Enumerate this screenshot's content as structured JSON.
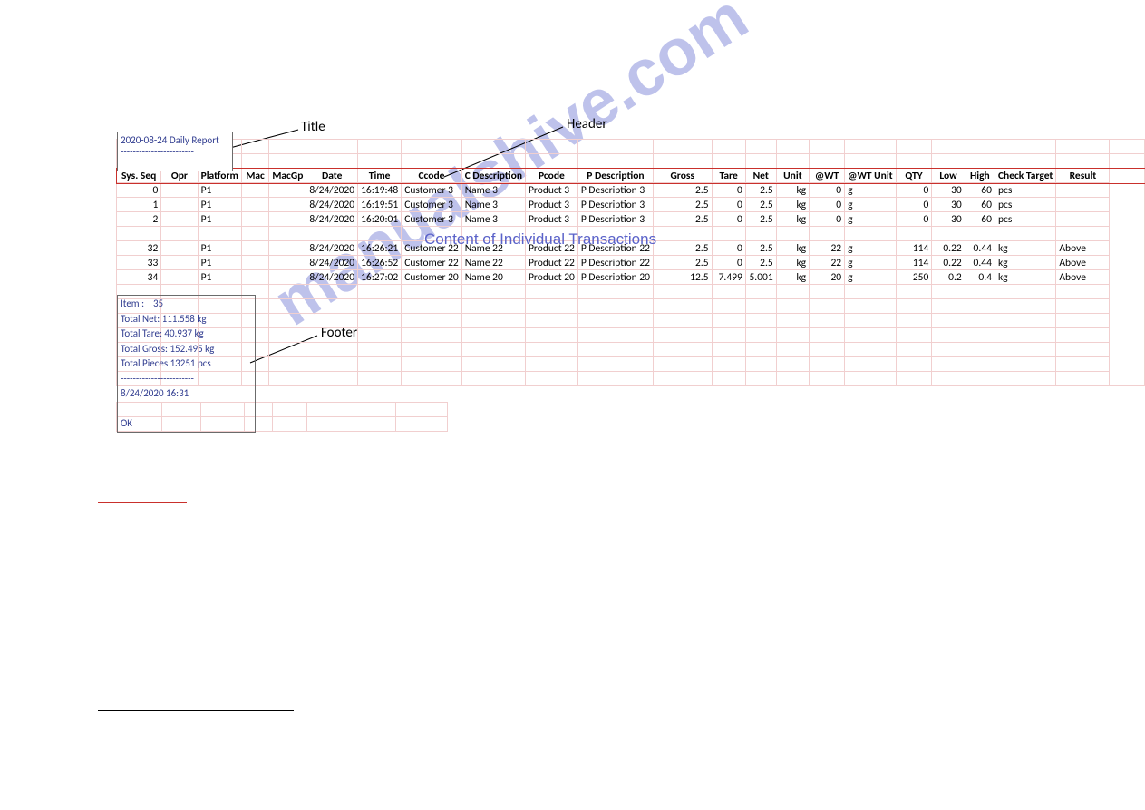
{
  "labels": {
    "title": "Title",
    "header": "Header",
    "footer": "Footer",
    "content_overlay": "Content of Individual Transactions",
    "watermark": "manualshive.com"
  },
  "title_box": {
    "line1": "2020-08-24 Daily Report",
    "line2": "------------------------"
  },
  "table": {
    "headers": [
      "Sys. Seq",
      "Opr",
      "Platform",
      "Mac",
      "MacGp",
      "Date",
      "Time",
      "Ccode",
      "C Description",
      "Pcode",
      "P Description",
      "Gross",
      "Tare",
      "Net",
      "Unit",
      "@WT",
      "@WT Unit",
      "QTY",
      "Low",
      "High",
      "Check Target",
      "Result"
    ],
    "rows_top": [
      {
        "seq": "0",
        "opr": "",
        "platform": "P1",
        "mac": "",
        "macgp": "",
        "date": "8/24/2020",
        "time": "16:19:48",
        "ccode": "Customer 3",
        "cdesc": "Name 3",
        "pcode": "Product 3",
        "pdesc": "P Description 3",
        "gross": "2.5",
        "tare": "0",
        "net": "2.5",
        "unit": "kg",
        "awt": "0",
        "awtu": "g",
        "qty": "0",
        "low": "30",
        "high": "60",
        "ct": "pcs",
        "res": ""
      },
      {
        "seq": "1",
        "opr": "",
        "platform": "P1",
        "mac": "",
        "macgp": "",
        "date": "8/24/2020",
        "time": "16:19:51",
        "ccode": "Customer 3",
        "cdesc": "Name 3",
        "pcode": "Product 3",
        "pdesc": "P Description 3",
        "gross": "2.5",
        "tare": "0",
        "net": "2.5",
        "unit": "kg",
        "awt": "0",
        "awtu": "g",
        "qty": "0",
        "low": "30",
        "high": "60",
        "ct": "pcs",
        "res": ""
      },
      {
        "seq": "2",
        "opr": "",
        "platform": "P1",
        "mac": "",
        "macgp": "",
        "date": "8/24/2020",
        "time": "16:20:01",
        "ccode": "Customer 3",
        "cdesc": "Name 3",
        "pcode": "Product 3",
        "pdesc": "P Description 3",
        "gross": "2.5",
        "tare": "0",
        "net": "2.5",
        "unit": "kg",
        "awt": "0",
        "awtu": "g",
        "qty": "0",
        "low": "30",
        "high": "60",
        "ct": "pcs",
        "res": ""
      }
    ],
    "rows_bottom": [
      {
        "seq": "32",
        "opr": "",
        "platform": "P1",
        "mac": "",
        "macgp": "",
        "date": "8/24/2020",
        "time": "16:26:21",
        "ccode": "Customer 22",
        "cdesc": "Name 22",
        "pcode": "Product 22",
        "pdesc": "P Description 22",
        "gross": "2.5",
        "tare": "0",
        "net": "2.5",
        "unit": "kg",
        "awt": "22",
        "awtu": "g",
        "qty": "114",
        "low": "0.22",
        "high": "0.44",
        "ct": "kg",
        "res": "Above"
      },
      {
        "seq": "33",
        "opr": "",
        "platform": "P1",
        "mac": "",
        "macgp": "",
        "date": "8/24/2020",
        "time": "16:26:52",
        "ccode": "Customer 22",
        "cdesc": "Name 22",
        "pcode": "Product 22",
        "pdesc": "P Description 22",
        "gross": "2.5",
        "tare": "0",
        "net": "2.5",
        "unit": "kg",
        "awt": "22",
        "awtu": "g",
        "qty": "114",
        "low": "0.22",
        "high": "0.44",
        "ct": "kg",
        "res": "Above"
      },
      {
        "seq": "34",
        "opr": "",
        "platform": "P1",
        "mac": "",
        "macgp": "",
        "date": "8/24/2020",
        "time": "16:27:02",
        "ccode": "Customer 20",
        "cdesc": "Name 20",
        "pcode": "Product 20",
        "pdesc": "P Description 20",
        "gross": "12.5",
        "tare": "7.499",
        "net": "5.001",
        "unit": "kg",
        "awt": "20",
        "awtu": "g",
        "qty": "250",
        "low": "0.2",
        "high": "0.4",
        "ct": "kg",
        "res": "Above"
      }
    ]
  },
  "footer": {
    "item_label": "Item :",
    "item_value": "35",
    "net": "Total Net:   111.558 kg",
    "tare": "Total Tare:   40.937 kg",
    "gross": "Total Gross: 152.495 kg",
    "pieces": "Total Pieces   13251 pcs",
    "dashes": "------------------------",
    "ts": "8/24/2020 16:31",
    "ok": "OK"
  }
}
